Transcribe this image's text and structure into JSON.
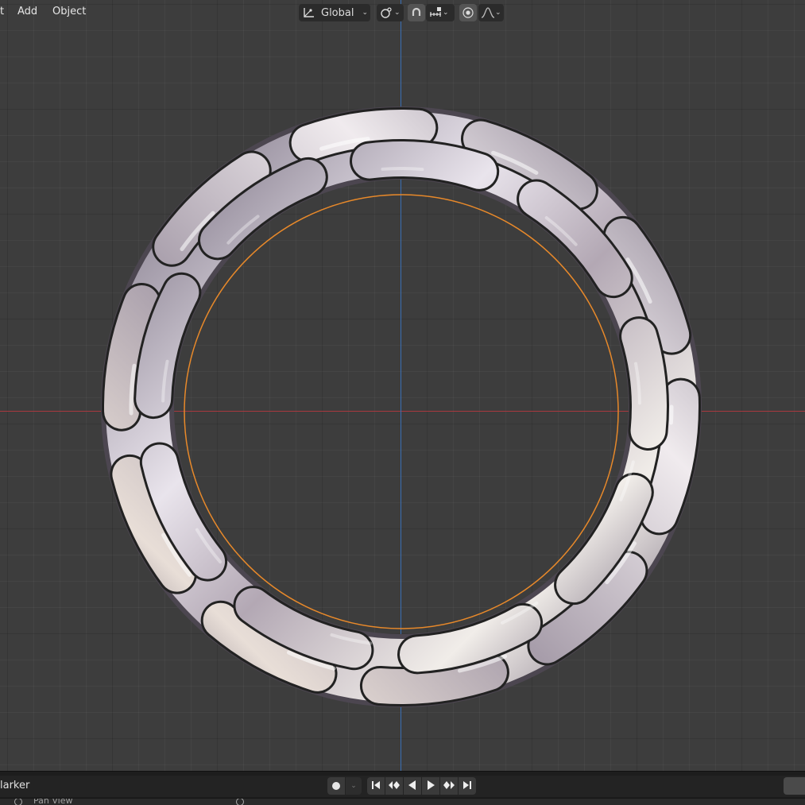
{
  "header": {
    "menu": [
      {
        "label": "t"
      },
      {
        "label": "Add"
      },
      {
        "label": "Object"
      }
    ],
    "transform_orientation": "Global"
  },
  "timeline": {
    "menu_label": "larker",
    "sub_label": "Pan View"
  },
  "colors": {
    "viewport_bg": "#3d3d3d",
    "x_axis": "#a8383f",
    "y_axis": "#3a6fb5",
    "selection_outline": "#e8892a",
    "ring_metal": "#c9c2cc"
  },
  "icons": {
    "transform_pivot": "axes-pivot-icon",
    "snap": "snap-icon",
    "magnet": "magnet-icon",
    "increment": "increment-icon",
    "proportional": "proportional-edit-icon",
    "falloff": "falloff-curve-icon"
  }
}
